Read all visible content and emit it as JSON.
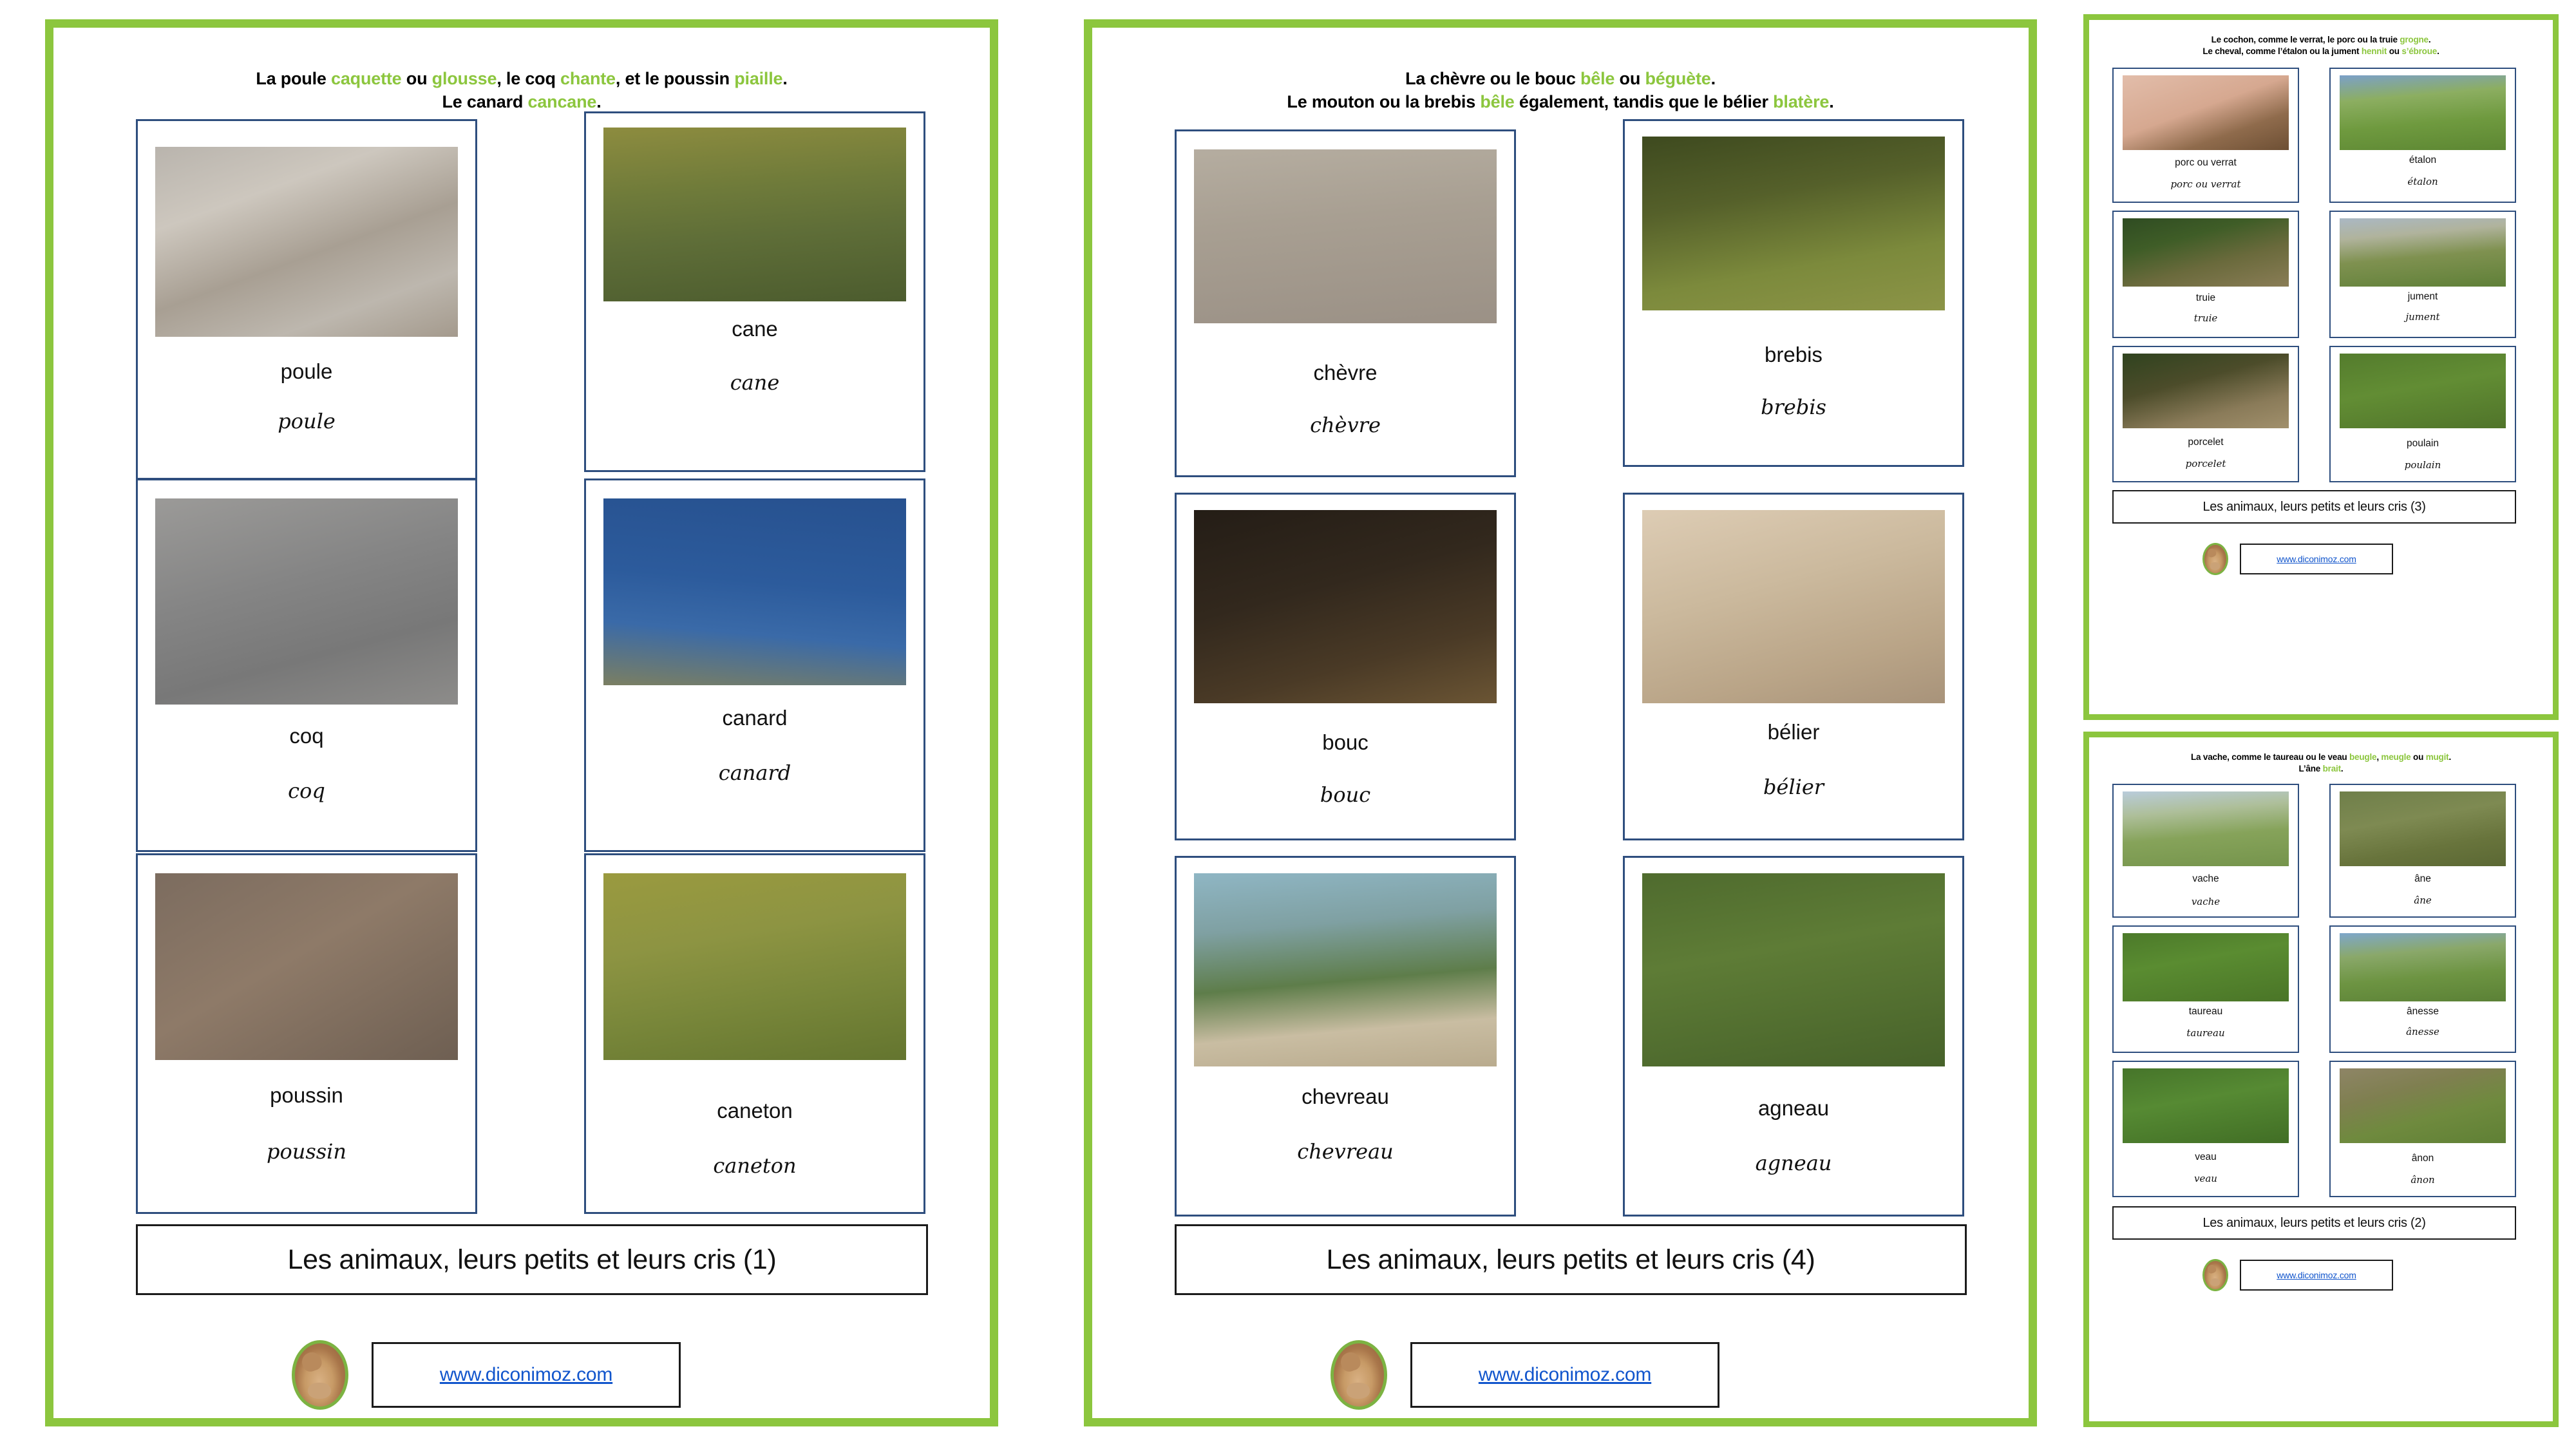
{
  "colors": {
    "frame_green": "#8CC63E",
    "card_border": "#2E4E7E",
    "cry_green": "#8CC63E",
    "link_blue": "#1155CC",
    "text_black": "#111111"
  },
  "site": {
    "url": "www.diconimoz.com",
    "logo_name": "diconimoz-dog-logo"
  },
  "sheets": [
    {
      "id": "sheet-1",
      "title": "Les animaux, leurs petits et leurs cris (1)",
      "heading": {
        "line1": [
          {
            "t": "La poule ",
            "cry": false
          },
          {
            "t": "caquette",
            "cry": true
          },
          {
            "t": " ou ",
            "cry": false
          },
          {
            "t": "glousse",
            "cry": true
          },
          {
            "t": ", le coq ",
            "cry": false
          },
          {
            "t": "chante",
            "cry": true
          },
          {
            "t": ", et le poussin ",
            "cry": false
          },
          {
            "t": "piaille",
            "cry": true
          },
          {
            "t": ".",
            "cry": false
          }
        ],
        "line2": [
          {
            "t": "Le canard ",
            "cry": false
          },
          {
            "t": "cancane",
            "cry": true
          },
          {
            "t": ".",
            "cry": false
          }
        ]
      },
      "cards": [
        {
          "word": "poule",
          "cursive": "poule",
          "photo": "hen-on-gravel"
        },
        {
          "word": "cane",
          "cursive": "cane",
          "photo": "female-duck-swimming"
        },
        {
          "word": "coq",
          "cursive": "coq",
          "photo": "rooster-on-road"
        },
        {
          "word": "canard",
          "cursive": "canard",
          "photo": "mallard-drake-by-water"
        },
        {
          "word": "poussin",
          "cursive": "poussin",
          "photo": "yellow-chick-on-wood"
        },
        {
          "word": "caneton",
          "cursive": "caneton",
          "photo": "duckling-on-pond"
        }
      ]
    },
    {
      "id": "sheet-4",
      "title": "Les animaux, leurs petits et leurs cris (4)",
      "heading": {
        "line1": [
          {
            "t": "La chèvre ou le bouc ",
            "cry": false
          },
          {
            "t": "bêle",
            "cry": true
          },
          {
            "t": " ou ",
            "cry": false
          },
          {
            "t": "béguète",
            "cry": true
          },
          {
            "t": ".",
            "cry": false
          }
        ],
        "line2": [
          {
            "t": "Le mouton ou la brebis ",
            "cry": false
          },
          {
            "t": "bêle",
            "cry": true
          },
          {
            "t": " également, tandis que le bélier ",
            "cry": false
          },
          {
            "t": "blatère",
            "cry": true
          },
          {
            "t": ".",
            "cry": false
          }
        ]
      },
      "cards": [
        {
          "word": "chèvre",
          "cursive": "chèvre",
          "photo": "goat-lying-on-sand"
        },
        {
          "word": "brebis",
          "cursive": "brebis",
          "photo": "two-ewes-in-grass"
        },
        {
          "word": "bouc",
          "cursive": "bouc",
          "photo": "billy-goat-in-barn"
        },
        {
          "word": "bélier",
          "cursive": "bélier",
          "photo": "ram-with-curled-horns"
        },
        {
          "word": "chevreau",
          "cursive": "chevreau",
          "photo": "black-white-kid-goat"
        },
        {
          "word": "agneau",
          "cursive": "agneau",
          "photo": "lamb-in-meadow"
        }
      ]
    },
    {
      "id": "sheet-3",
      "title": "Les animaux, leurs petits et leurs cris (3)",
      "heading": {
        "line1": [
          {
            "t": "Le cochon, comme le verrat, le porc ou la truie ",
            "cry": false
          },
          {
            "t": "grogne",
            "cry": true
          },
          {
            "t": ".",
            "cry": false
          }
        ],
        "line2": [
          {
            "t": "Le cheval, comme l’étalon ou la jument ",
            "cry": false
          },
          {
            "t": "hennit",
            "cry": true
          },
          {
            "t": " ou ",
            "cry": false
          },
          {
            "t": "s’ébroue",
            "cry": true
          },
          {
            "t": ".",
            "cry": false
          }
        ]
      },
      "cards": [
        {
          "word": "porc ou verrat",
          "cursive": "porc ou verrat",
          "photo": "boar-head-closeup"
        },
        {
          "word": "étalon",
          "cursive": "étalon",
          "photo": "black-stallion-standing"
        },
        {
          "word": "truie",
          "cursive": "truie",
          "photo": "sow-in-profile"
        },
        {
          "word": "jument",
          "cursive": "jument",
          "photo": "mare-grazing"
        },
        {
          "word": "porcelet",
          "cursive": "porcelet",
          "photo": "spotted-piglet"
        },
        {
          "word": "poulain",
          "cursive": "poulain",
          "photo": "foal-lying-in-grass"
        }
      ]
    },
    {
      "id": "sheet-2",
      "title": "Les animaux, leurs petits et leurs cris (2)",
      "heading": {
        "line1": [
          {
            "t": "La vache, comme le taureau ou le veau ",
            "cry": false
          },
          {
            "t": "beugle",
            "cry": true
          },
          {
            "t": ", ",
            "cry": false
          },
          {
            "t": "meugle",
            "cry": true
          },
          {
            "t": " ou ",
            "cry": false
          },
          {
            "t": "mugit",
            "cry": true
          },
          {
            "t": ".",
            "cry": false
          }
        ],
        "line2": [
          {
            "t": "L’âne ",
            "cry": false
          },
          {
            "t": "brait",
            "cry": true
          },
          {
            "t": ".",
            "cry": false
          }
        ]
      },
      "cards": [
        {
          "word": "vache",
          "cursive": "vache",
          "photo": "herd-of-cows"
        },
        {
          "word": "âne",
          "cursive": "âne",
          "photo": "grey-donkey-front"
        },
        {
          "word": "taureau",
          "cursive": "taureau",
          "photo": "bull-in-pasture"
        },
        {
          "word": "ânesse",
          "cursive": "ânesse",
          "photo": "jenny-donkey-grazing"
        },
        {
          "word": "veau",
          "cursive": "veau",
          "photo": "two-calves-in-grass"
        },
        {
          "word": "ânon",
          "cursive": "ânon",
          "photo": "donkey-foal"
        }
      ]
    }
  ]
}
